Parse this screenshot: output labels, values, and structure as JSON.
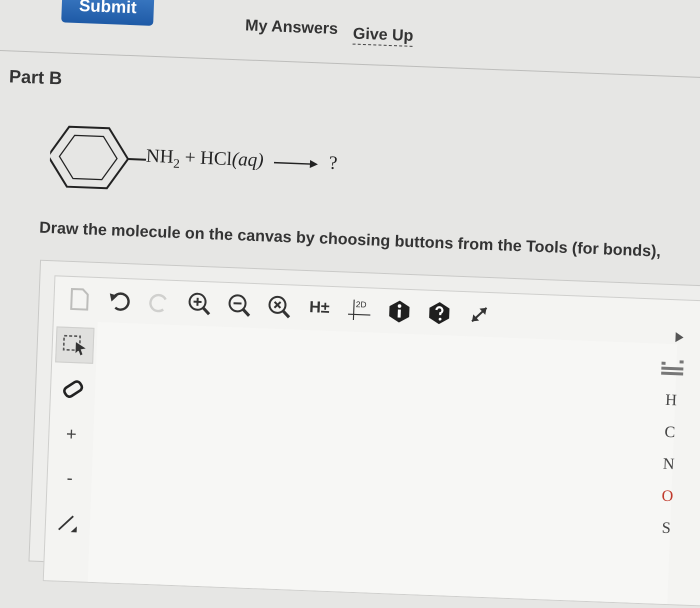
{
  "toolbar_top": {
    "submit_label": "Submit",
    "my_answers_label": "My Answers",
    "give_up_label": "Give Up"
  },
  "part": {
    "title": "Part B"
  },
  "reaction": {
    "reactant_group": "NH",
    "reactant_sub": "2",
    "plus": "+",
    "reagent": "HCl",
    "reagent_state": "(aq)",
    "product": "?"
  },
  "instruction": "Draw the molecule on the canvas by choosing buttons from the Tools (for bonds),",
  "editor": {
    "toolbar": {
      "h_label": "H±",
      "label_2d": "2D"
    },
    "left_tools": {
      "plus": "+",
      "minus": "-"
    },
    "elements": [
      "H",
      "C",
      "N",
      "O",
      "S"
    ]
  },
  "colors": {
    "submit_blue": "#1e5aa6",
    "oxygen_red": "#c0392b"
  }
}
